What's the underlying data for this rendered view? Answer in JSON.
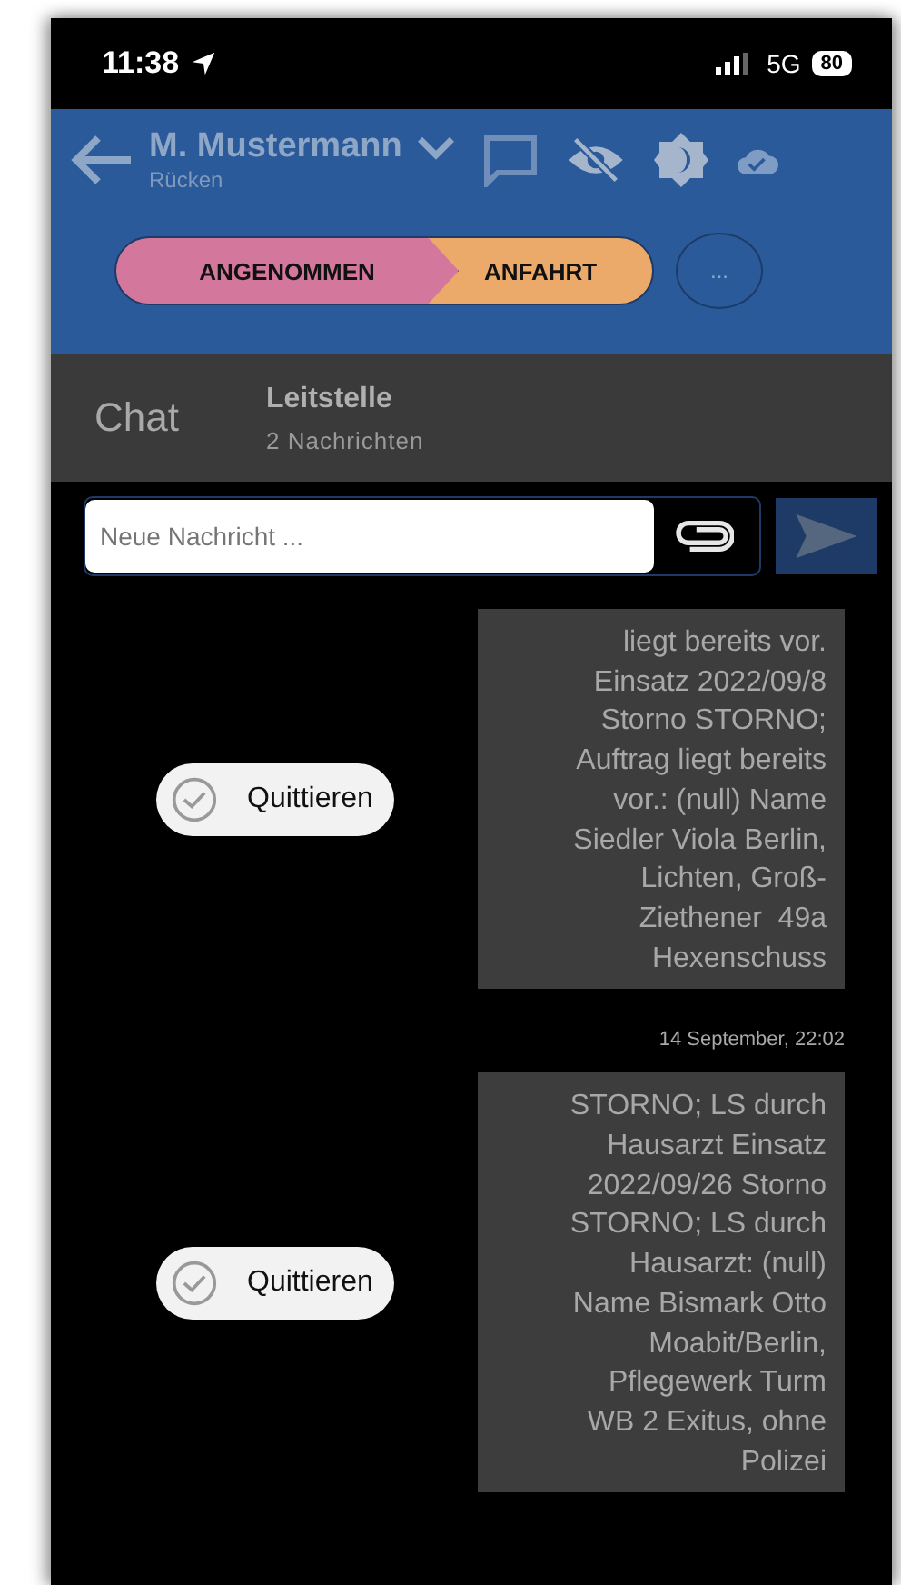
{
  "status_bar": {
    "time": "11:38",
    "network": "5G",
    "battery": "80"
  },
  "header": {
    "title": "M. Mustermann",
    "subtitle": "Rücken"
  },
  "steps": [
    {
      "label": "ANGENOMMEN",
      "color": "#d4779c"
    },
    {
      "label": "ANFAHRT",
      "color": "#eba96a"
    }
  ],
  "more_button": "...",
  "chat_header": {
    "title": "Chat",
    "channel": "Leitstelle",
    "count": "2 Nachrichten"
  },
  "composer": {
    "placeholder": "Neue Nachricht ..."
  },
  "messages": [
    {
      "text": "liegt bereits vor.\nEinsatz 2022/09/8\nStorno STORNO;\nAuftrag liegt bereits\nvor.: (null) Name\nSiedler Viola Berlin,\nLichten, Groß-\nZiethener  49a\nHexenschuss",
      "action": "Quittieren"
    },
    {
      "date": "14 September, 22:02",
      "text": "STORNO; LS durch\nHausarzt Einsatz\n2022/09/26 Storno\nSTORNO; LS durch\nHausarzt: (null)\nName Bismark Otto\nMoabit/Berlin,\nPflegewerk Turm\nWB 2 Exitus, ohne\nPolizei",
      "action": "Quittieren"
    }
  ]
}
